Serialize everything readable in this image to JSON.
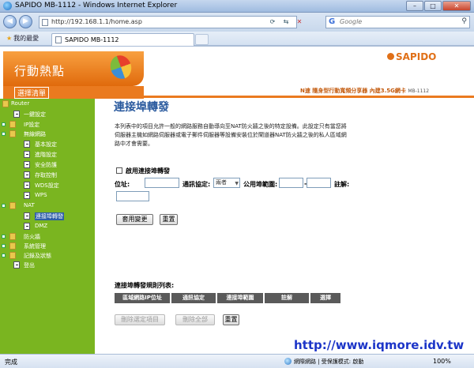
{
  "window": {
    "title": "SAPIDO MB-1112 - Windows Internet Explorer",
    "minimize": "–",
    "maximize": "□",
    "close": "✕"
  },
  "address_bar": {
    "url": "http://192.168.1.1/home.asp",
    "search_placeholder": "Google",
    "search_engine_glyph": "G"
  },
  "tabs": {
    "favorites_label": "我的最愛",
    "active_tab_label": "SAPIDO MB-1112"
  },
  "header": {
    "brand_area_text": "行動熱點",
    "menu_label": "選擇清單",
    "logo_text": "SAPIDO",
    "subtitle": "N速 隨身型行動寬頻分享器 內建3.5G網卡",
    "model": "MB-1112"
  },
  "sidebar": {
    "items": [
      {
        "label": "Router",
        "type": "folder-open",
        "level": 0
      },
      {
        "label": "一鍵設定",
        "type": "page",
        "level": 1
      },
      {
        "label": "IP設定",
        "type": "folder",
        "level": 0
      },
      {
        "label": "無線網路",
        "type": "folder-open",
        "level": 0
      },
      {
        "label": "基本設定",
        "type": "page",
        "level": 2
      },
      {
        "label": "進階設定",
        "type": "page",
        "level": 2
      },
      {
        "label": "安全防護",
        "type": "page",
        "level": 2
      },
      {
        "label": "存取控制",
        "type": "page",
        "level": 2
      },
      {
        "label": "WDS設定",
        "type": "page",
        "level": 2
      },
      {
        "label": "WPS",
        "type": "page",
        "level": 2
      },
      {
        "label": "NAT",
        "type": "folder-open",
        "level": 0
      },
      {
        "label": "連接埠轉發",
        "type": "page",
        "level": 2,
        "selected": true
      },
      {
        "label": "DMZ",
        "type": "page",
        "level": 2
      },
      {
        "label": "防火牆",
        "type": "folder",
        "level": 0
      },
      {
        "label": "系統管理",
        "type": "folder",
        "level": 0
      },
      {
        "label": "記錄及狀態",
        "type": "folder",
        "level": 0
      },
      {
        "label": "登出",
        "type": "page",
        "level": 1
      }
    ]
  },
  "main": {
    "title": "連接埠轉發",
    "description": "本列表中的項目允許一般的網路服務自動導向至NAT防火牆之後的特定設備。此設定只有當您將伺服器主機如網路伺服器或電子郵件伺服器等設備安裝位於閘道器NAT防火牆之後的私人區域網路中才會需要。",
    "enable_label": "啟用連接埠轉發",
    "enable_checked": false,
    "ip_label": "位址:",
    "ip_value": "",
    "protocol_label": "通訊協定:",
    "protocol_value": "兩者",
    "port_label": "公用埠範圍:",
    "port_sep": "-",
    "port_from": "",
    "port_to": "",
    "comment_label": "註解:",
    "comment_value": "",
    "apply_button": "套用變更",
    "reset_button": "重置",
    "list_title": "連接埠轉發規則列表:",
    "table_headers": [
      "區域網路IP位址",
      "通訊協定",
      "連接埠範圍",
      "註解",
      "選擇"
    ],
    "delete_selected_button": "刪除選定項目",
    "delete_all_button": "刪除全部",
    "list_reset_button": "重置"
  },
  "status_bar": {
    "status": "完成",
    "zone": "網際網路 | 受保護模式: 啟動",
    "zoom": "100%"
  },
  "watermark": "http://www.iqmore.idv.tw"
}
